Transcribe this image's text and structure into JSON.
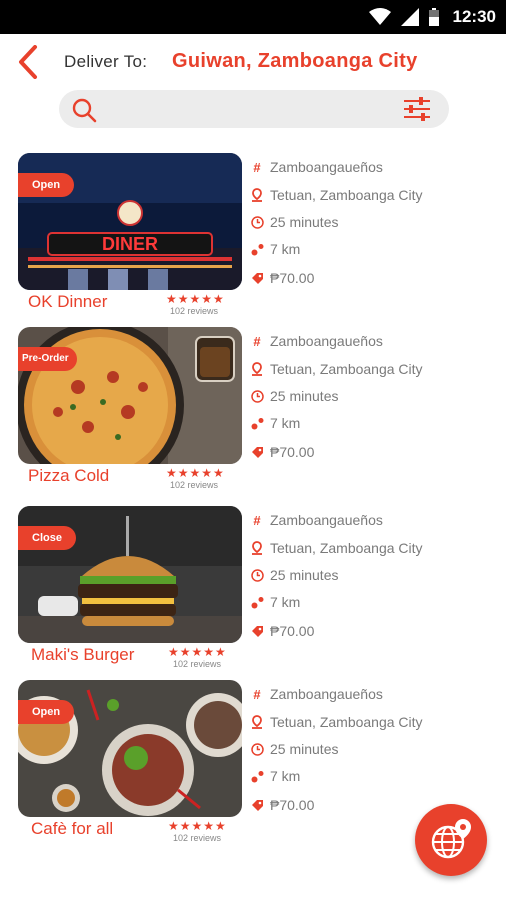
{
  "status_bar": {
    "time": "12:30"
  },
  "header": {
    "deliver_label": "Deliver To:",
    "deliver_location": "Guiwan, Zamboanga City"
  },
  "search": {
    "placeholder": ""
  },
  "restaurants": [
    {
      "name": "OK Dinner",
      "status": "Open",
      "sign_text": "DINER",
      "category": "Zamboangaueños",
      "location": "Tetuan, Zamboanga City",
      "time": "25 minutes",
      "distance": "7 km",
      "price": "₱70.00",
      "stars": "★★★★★",
      "reviews": "102 reviews"
    },
    {
      "name": "Pizza Cold",
      "status": "Pre-Order",
      "category": "Zamboangaueños",
      "location": "Tetuan, Zamboanga City",
      "time": "25 minutes",
      "distance": "7 km",
      "price": "₱70.00",
      "stars": "★★★★★",
      "reviews": "102 reviews"
    },
    {
      "name": "Maki's Burger",
      "status": "Close",
      "category": "Zamboangaueños",
      "location": "Tetuan, Zamboanga City",
      "time": "25 minutes",
      "distance": "7 km",
      "price": "₱70.00",
      "stars": "★★★★★",
      "reviews": "102 reviews"
    },
    {
      "name": "Cafè for all",
      "status": "Open",
      "category": "Zamboangaueños",
      "location": "Tetuan, Zamboanga City",
      "time": "25 minutes",
      "distance": "7 km",
      "price": "₱70.00",
      "stars": "★★★★★",
      "reviews": "102 reviews"
    }
  ],
  "colors": {
    "accent": "#e8412c",
    "muted_text": "#7a7a7a",
    "search_bg": "#ececec"
  },
  "icons": {
    "category": "hash-icon",
    "location": "map-pin-icon",
    "time": "clock-icon",
    "distance": "route-icon",
    "price": "price-tag-icon",
    "fab": "globe-location-icon"
  }
}
